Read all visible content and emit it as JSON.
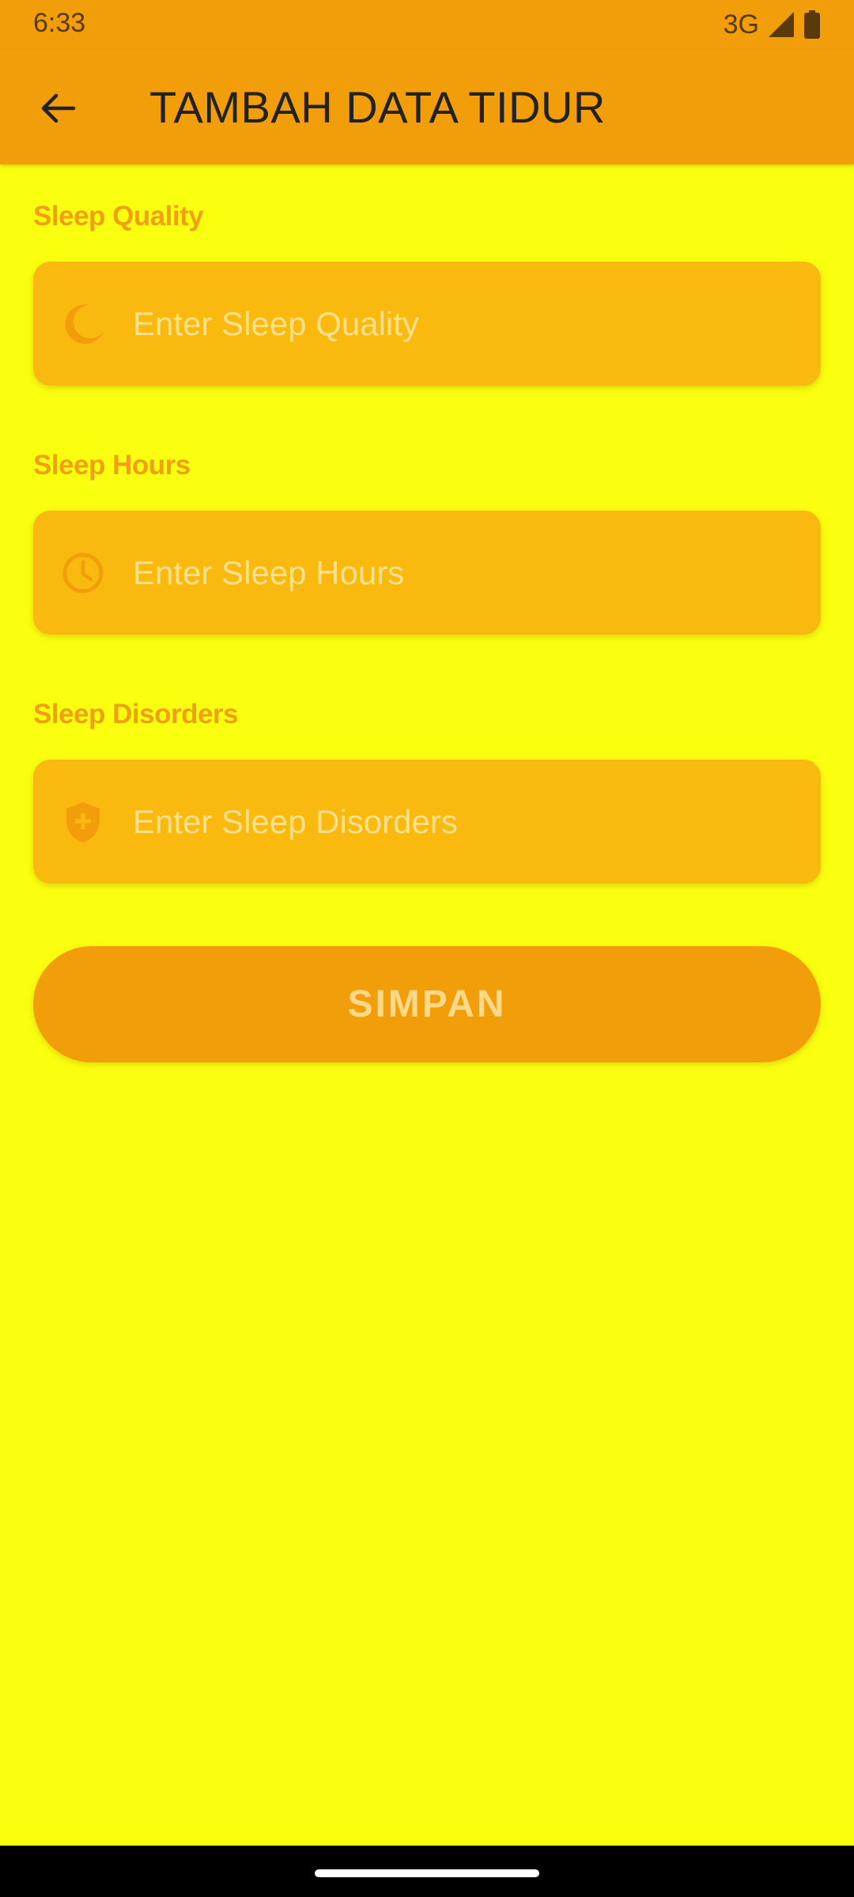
{
  "status_bar": {
    "time": "6:33",
    "network": "3G",
    "signal_icon": "cellular-signal-icon",
    "battery_icon": "battery-icon"
  },
  "app_bar": {
    "back_icon": "arrow-back-icon",
    "title": "TAMBAH DATA TIDUR"
  },
  "form": {
    "fields": [
      {
        "label": "Sleep Quality",
        "placeholder": "Enter Sleep Quality",
        "value": "",
        "icon": "moon-icon"
      },
      {
        "label": "Sleep Hours",
        "placeholder": "Enter Sleep Hours",
        "value": "",
        "icon": "clock-icon"
      },
      {
        "label": "Sleep Disorders",
        "placeholder": "Enter Sleep Disorders",
        "value": "",
        "icon": "shield-plus-icon"
      }
    ],
    "save_label": "SIMPAN"
  },
  "colors": {
    "background": "#FAFF0F",
    "app_bar": "#F29E0A",
    "input_card": "#F9B90F",
    "label": "#F0A012",
    "placeholder": "#FCE08A",
    "button": "#F29E0A",
    "button_text": "#FCD98A"
  }
}
